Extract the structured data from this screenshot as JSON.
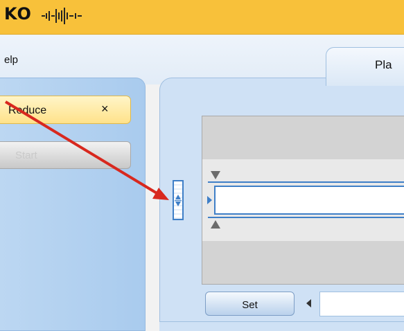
{
  "brand": {
    "logo_text": "KO"
  },
  "menu": {
    "help_label": "elp"
  },
  "tabs": [
    {
      "label": "Pla"
    }
  ],
  "left_panel": {
    "reduce_label": "Reduce",
    "reduce_close": "×",
    "start_label": "Start"
  },
  "main": {
    "set_label": "Set",
    "value_input": "",
    "bottom_input": ""
  },
  "colors": {
    "brand_bar": "#f8c13a",
    "accent_blue": "#3f7fc7",
    "annotation_arrow": "#d8281e",
    "highlight_pill": "#ffe28a"
  }
}
